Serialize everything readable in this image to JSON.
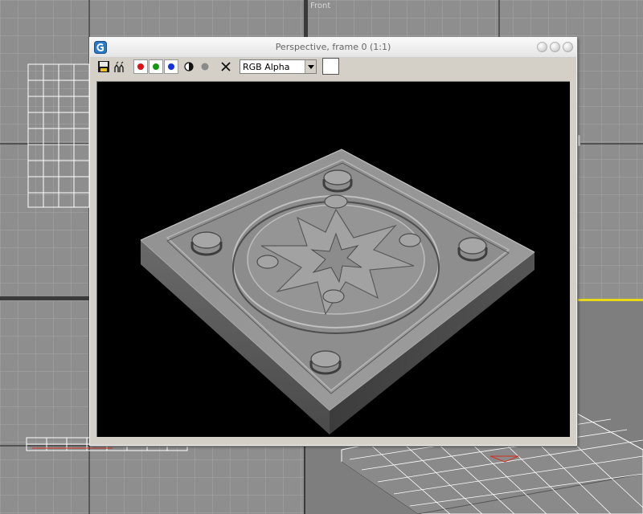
{
  "viewport": {
    "front_label": "Front"
  },
  "render_window": {
    "title": "Perspective, frame 0 (1:1)",
    "icons": {
      "app": "app-logo-icon",
      "save": "save-icon",
      "clone": "clone-window-icon",
      "red_channel": "red-channel-icon",
      "green_channel": "green-channel-icon",
      "blue_channel": "blue-channel-icon",
      "alpha": "display-alpha-icon",
      "mono": "monochrome-icon",
      "clear": "clear-icon"
    },
    "channel_colors": {
      "red": "#dd1111",
      "green": "#119911",
      "blue": "#1133dd"
    },
    "channel_dropdown": {
      "selected": "RGB Alpha"
    },
    "swatch_color": "#ffffff",
    "render_background": "#000000"
  }
}
